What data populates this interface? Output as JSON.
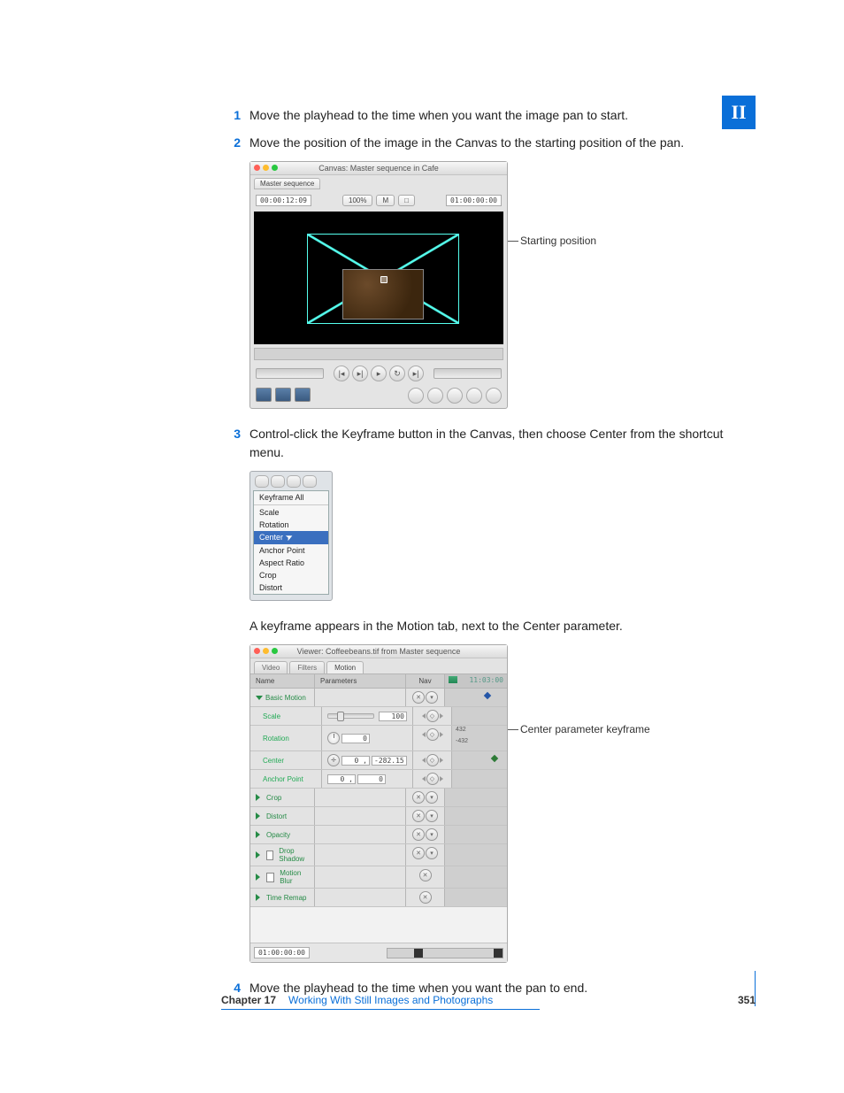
{
  "part_tab": "II",
  "steps": [
    {
      "num": "1",
      "text": "Move the playhead to the time when you want the image pan to start."
    },
    {
      "num": "2",
      "text": "Move the position of the image in the Canvas to the starting position of the pan."
    },
    {
      "num": "3",
      "text": "Control-click the Keyframe button in the Canvas, then choose Center from the shortcut menu."
    },
    {
      "num": "4",
      "text": "Move the playhead to the time when you want the pan to end."
    }
  ],
  "step3_sub": "A keyframe appears in the Motion tab, next to the Center parameter.",
  "callouts": {
    "fig1": "Starting position",
    "fig3": "Center parameter keyframe"
  },
  "canvas": {
    "title": "Canvas: Master sequence in Cafe",
    "tab": "Master sequence",
    "tc_left": "00:00:12:09",
    "tc_right": "01:00:00:00",
    "fit_buttons": [
      "100%",
      "M",
      "□"
    ]
  },
  "context_menu": {
    "header": "Keyframe All",
    "items": [
      "Scale",
      "Rotation",
      "Center",
      "Anchor Point",
      "Aspect Ratio",
      "Crop",
      "Distort"
    ],
    "selected": "Center"
  },
  "viewer": {
    "title": "Viewer: Coffeebeans.tif from Master sequence",
    "tabs": [
      "Video",
      "Filters",
      "Motion"
    ],
    "active_tab": "Motion",
    "columns": {
      "name": "Name",
      "parameters": "Parameters",
      "nav": "Nav"
    },
    "tc_right": "11:03:00",
    "tc_footer": "01:00:00:00",
    "rows": {
      "basic_motion": "Basic Motion",
      "scale": {
        "label": "Scale",
        "value": "100"
      },
      "rotation": {
        "label": "Rotation",
        "value": "0",
        "range_hi": "432",
        "range_lo": "-432"
      },
      "center": {
        "label": "Center",
        "x": "0 ,",
        "y": "-282.15"
      },
      "anchor": {
        "label": "Anchor Point",
        "x": "0 ,",
        "y": "0"
      },
      "crop": "Crop",
      "distort": "Distort",
      "opacity": "Opacity",
      "drop": "Drop Shadow",
      "mblur": "Motion Blur",
      "tremap": "Time Remap"
    }
  },
  "footer": {
    "chapter": "Chapter 17",
    "title": "Working With Still Images and Photographs",
    "page": "351"
  }
}
